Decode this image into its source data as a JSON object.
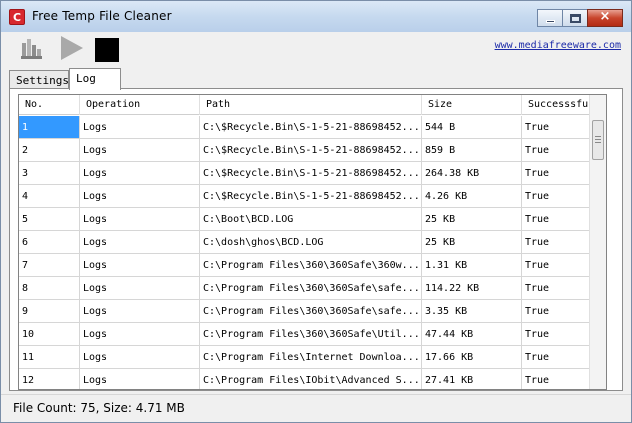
{
  "window": {
    "title": "Free Temp File Cleaner",
    "icon_letter": "C",
    "close_glyph": "×"
  },
  "toolbar": {
    "clean_icon": "broom-clean-icon",
    "play_icon": "play-icon",
    "stop_icon": "stop-icon",
    "link_text": "www.mediafreeware.com"
  },
  "tabs": [
    {
      "label": "Settings",
      "active": false
    },
    {
      "label": "Log",
      "active": true
    }
  ],
  "table": {
    "columns": [
      "No.",
      "Operation",
      "Path",
      "Size",
      "Successsful"
    ],
    "rows": [
      {
        "no": "1",
        "operation": "Logs",
        "path": "C:\\$Recycle.Bin\\S-1-5-21-88698452...",
        "size": "544 B",
        "success": "True"
      },
      {
        "no": "2",
        "operation": "Logs",
        "path": "C:\\$Recycle.Bin\\S-1-5-21-88698452...",
        "size": "859 B",
        "success": "True"
      },
      {
        "no": "3",
        "operation": "Logs",
        "path": "C:\\$Recycle.Bin\\S-1-5-21-88698452...",
        "size": "264.38 KB",
        "success": "True"
      },
      {
        "no": "4",
        "operation": "Logs",
        "path": "C:\\$Recycle.Bin\\S-1-5-21-88698452...",
        "size": "4.26 KB",
        "success": "True"
      },
      {
        "no": "5",
        "operation": "Logs",
        "path": "C:\\Boot\\BCD.LOG",
        "size": "25 KB",
        "success": "True"
      },
      {
        "no": "6",
        "operation": "Logs",
        "path": "C:\\dosh\\ghos\\BCD.LOG",
        "size": "25 KB",
        "success": "True"
      },
      {
        "no": "7",
        "operation": "Logs",
        "path": "C:\\Program Files\\360\\360Safe\\360w...",
        "size": "1.31 KB",
        "success": "True"
      },
      {
        "no": "8",
        "operation": "Logs",
        "path": "C:\\Program Files\\360\\360Safe\\safe...",
        "size": "114.22 KB",
        "success": "True"
      },
      {
        "no": "9",
        "operation": "Logs",
        "path": "C:\\Program Files\\360\\360Safe\\safe...",
        "size": "3.35 KB",
        "success": "True"
      },
      {
        "no": "10",
        "operation": "Logs",
        "path": "C:\\Program Files\\360\\360Safe\\Util...",
        "size": "47.44 KB",
        "success": "True"
      },
      {
        "no": "11",
        "operation": "Logs",
        "path": "C:\\Program Files\\Internet Downloa...",
        "size": "17.66 KB",
        "success": "True"
      },
      {
        "no": "12",
        "operation": "Logs",
        "path": "C:\\Program Files\\IObit\\Advanced S...",
        "size": "27.41 KB",
        "success": "True"
      }
    ],
    "selected_row": 0
  },
  "status": {
    "text": "File Count: 75, Size: 4.71 MB"
  }
}
